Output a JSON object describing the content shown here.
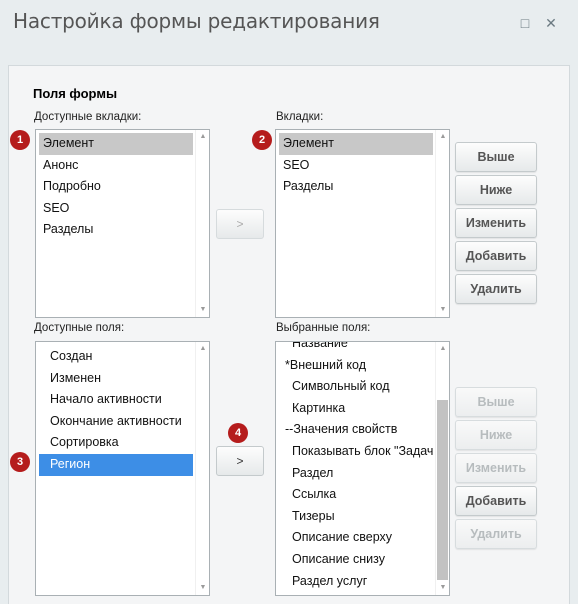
{
  "window": {
    "title": "Настройка формы редактирования",
    "restore_icon": "□",
    "close_icon": "✕"
  },
  "form": {
    "section_title": "Поля формы",
    "available_tabs_label": "Доступные вкладки:",
    "tabs_label": "Вкладки:",
    "available_fields_label": "Доступные поля:",
    "selected_fields_label": "Выбранные поля:"
  },
  "available_tabs": {
    "items": [
      "Элемент",
      "Анонс",
      "Подробно",
      "SEO",
      "Разделы"
    ],
    "selected_index": 0
  },
  "tabs": {
    "items": [
      "Элемент",
      "SEO",
      "Разделы"
    ],
    "selected_index": 0
  },
  "available_fields": {
    "items": [
      "Создан",
      "Изменен",
      "Начало активности",
      "Окончание активности",
      "Сортировка",
      "Регион"
    ],
    "selected_index": 5
  },
  "selected_fields": {
    "items": [
      "Название",
      "*Внешний код",
      "Символьный код",
      "Картинка",
      "--Значения свойств",
      "Показывать блок \"Задача\"",
      "Раздел",
      "Ссылка",
      "Тизеры",
      "Описание сверху",
      "Описание снизу",
      "Раздел услуг"
    ]
  },
  "buttons": {
    "move_tab": ">",
    "move_field": ">",
    "up": "Выше",
    "down": "Ниже",
    "edit": "Изменить",
    "add": "Добавить",
    "delete": "Удалить"
  },
  "badges": [
    "1",
    "2",
    "3",
    "4"
  ],
  "colors": {
    "badge": "#b51c1c",
    "selection_blue": "#3d8ee6",
    "selection_gray": "#c8c8c8"
  }
}
